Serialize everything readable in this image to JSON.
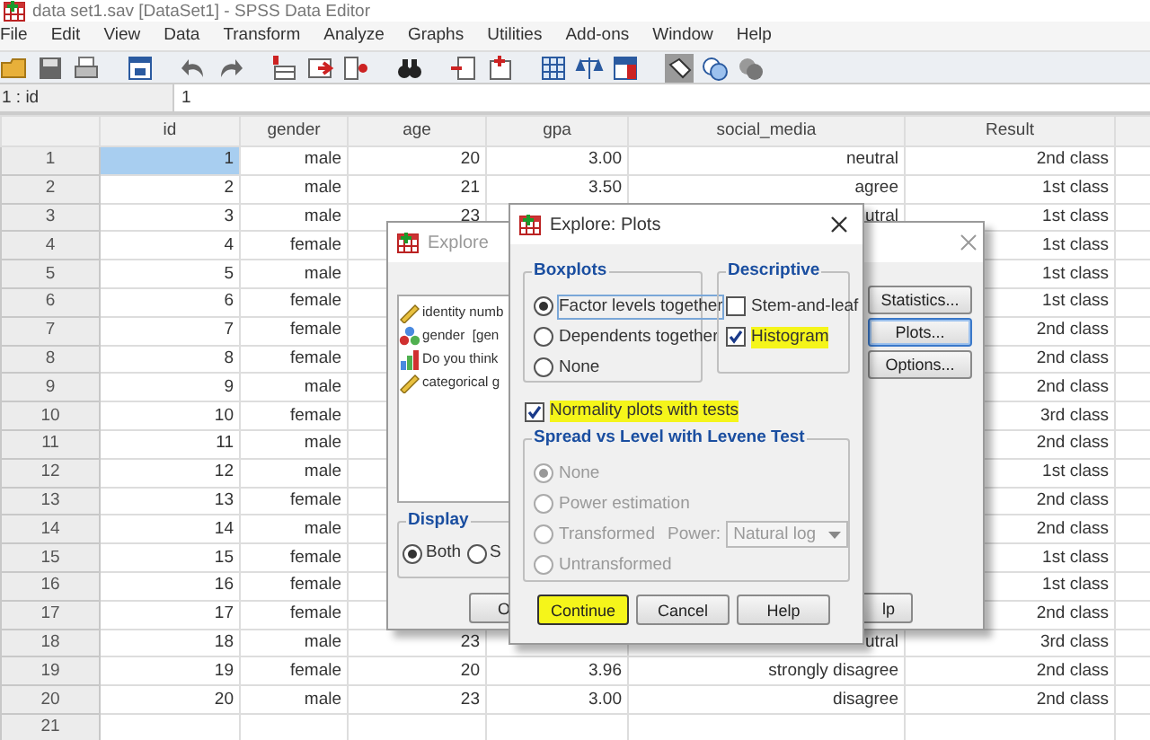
{
  "window": {
    "title": "data set1.sav [DataSet1] - SPSS Data Editor"
  },
  "menu": [
    "File",
    "Edit",
    "View",
    "Data",
    "Transform",
    "Analyze",
    "Graphs",
    "Utilities",
    "Add-ons",
    "Window",
    "Help"
  ],
  "cell_ref": {
    "name": "1 : id",
    "value": "1"
  },
  "table": {
    "columns": [
      "id",
      "gender",
      "age",
      "gpa",
      "social_media",
      "Result"
    ],
    "rows": [
      {
        "row": "1",
        "selected": true,
        "cells": [
          "1",
          "male",
          "20",
          "3.00",
          "neutral",
          "2nd class"
        ]
      },
      {
        "row": "2",
        "selected": false,
        "cells": [
          "2",
          "male",
          "21",
          "3.50",
          "agree",
          "1st class"
        ]
      },
      {
        "row": "3",
        "selected": false,
        "cells": [
          "3",
          "male",
          "23",
          null,
          "utral",
          "1st class"
        ]
      },
      {
        "row": "4",
        "selected": false,
        "cells": [
          "4",
          "female",
          null,
          null,
          null,
          "1st class"
        ]
      },
      {
        "row": "5",
        "selected": false,
        "cells": [
          "5",
          "male",
          null,
          null,
          null,
          "1st class"
        ]
      },
      {
        "row": "6",
        "selected": false,
        "cells": [
          "6",
          "female",
          null,
          null,
          null,
          "1st class"
        ]
      },
      {
        "row": "7",
        "selected": false,
        "cells": [
          "7",
          "female",
          null,
          null,
          null,
          "2nd class"
        ]
      },
      {
        "row": "8",
        "selected": false,
        "cells": [
          "8",
          "female",
          null,
          null,
          null,
          "2nd class"
        ]
      },
      {
        "row": "9",
        "selected": false,
        "cells": [
          "9",
          "male",
          null,
          null,
          null,
          "2nd class"
        ]
      },
      {
        "row": "10",
        "selected": false,
        "cells": [
          "10",
          "female",
          null,
          null,
          null,
          "3rd class"
        ]
      },
      {
        "row": "11",
        "selected": false,
        "cells": [
          "11",
          "male",
          null,
          null,
          null,
          "2nd class"
        ]
      },
      {
        "row": "12",
        "selected": false,
        "cells": [
          "12",
          "male",
          null,
          null,
          null,
          "1st class"
        ]
      },
      {
        "row": "13",
        "selected": false,
        "cells": [
          "13",
          "female",
          null,
          null,
          null,
          "2nd class"
        ]
      },
      {
        "row": "14",
        "selected": false,
        "cells": [
          "14",
          "male",
          null,
          null,
          null,
          "2nd class"
        ]
      },
      {
        "row": "15",
        "selected": false,
        "cells": [
          "15",
          "female",
          null,
          null,
          null,
          "1st class"
        ]
      },
      {
        "row": "16",
        "selected": false,
        "cells": [
          "16",
          "female",
          null,
          null,
          null,
          "1st class"
        ]
      },
      {
        "row": "17",
        "selected": false,
        "cells": [
          "17",
          "female",
          null,
          null,
          null,
          "2nd class"
        ]
      },
      {
        "row": "18",
        "selected": false,
        "cells": [
          "18",
          "male",
          "23",
          null,
          "utral",
          "3rd class"
        ]
      },
      {
        "row": "19",
        "selected": false,
        "cells": [
          "19",
          "female",
          "20",
          "3.96",
          "strongly disagree",
          "2nd class"
        ]
      },
      {
        "row": "20",
        "selected": false,
        "cells": [
          "20",
          "male",
          "23",
          "3.00",
          "disagree",
          "2nd class"
        ]
      },
      {
        "row": "21",
        "selected": false
      }
    ]
  },
  "explore_dialog": {
    "title": "Explore",
    "active": false,
    "variables": [
      {
        "label": "identity numb",
        "kind": "scale"
      },
      {
        "label": "gender  [gen",
        "kind": "nominal"
      },
      {
        "label": "Do you think",
        "kind": "ordinal"
      },
      {
        "label": "categorical g",
        "kind": "scale"
      }
    ],
    "display": {
      "title": "Display",
      "options": [
        {
          "label": "Both",
          "selected": true
        },
        {
          "label": "S",
          "selected": false
        }
      ]
    },
    "side_buttons": [
      {
        "label": "Statistics...",
        "focused": false
      },
      {
        "label": "Plots...",
        "focused": true
      },
      {
        "label": "Options...",
        "focused": false
      }
    ],
    "bottom_buttons": [
      "O",
      "lp"
    ]
  },
  "plots_dialog": {
    "title": "Explore: Plots",
    "boxplots": {
      "title": "Boxplots",
      "options": [
        {
          "label": "Factor levels together",
          "selected": true,
          "focused": true
        },
        {
          "label": "Dependents together",
          "selected": false,
          "focused": false
        },
        {
          "label": "None",
          "selected": false,
          "focused": false
        }
      ]
    },
    "descriptive": {
      "title": "Descriptive",
      "options": [
        {
          "label": "Stem-and-leaf",
          "checked": false,
          "highlighted": false
        },
        {
          "label": "Histogram",
          "checked": true,
          "highlighted": true
        }
      ]
    },
    "normality": {
      "label": "Normality plots with tests",
      "checked": true,
      "highlighted": true
    },
    "spread": {
      "title": "Spread vs Level with Levene Test",
      "disabled": true,
      "options": [
        {
          "label": "None",
          "selected": true
        },
        {
          "label": "Power estimation",
          "selected": false
        },
        {
          "label": "Transformed",
          "selected": false,
          "power_label": "Power:",
          "power_value": "Natural log"
        },
        {
          "label": "Untransformed",
          "selected": false
        }
      ]
    },
    "buttons": [
      {
        "label": "Continue",
        "highlighted": true
      },
      {
        "label": "Cancel",
        "highlighted": false
      },
      {
        "label": "Help",
        "highlighted": false
      }
    ]
  }
}
